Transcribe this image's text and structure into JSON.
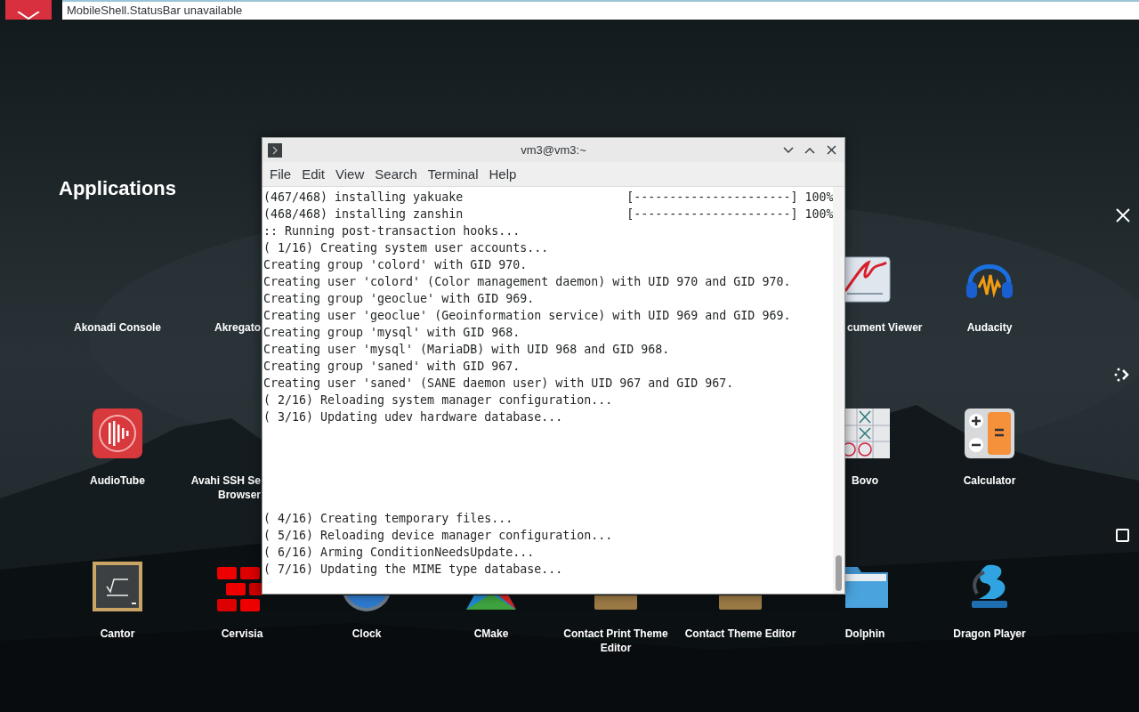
{
  "status_bar": {
    "text": "MobileShell.StatusBar unavailable"
  },
  "launcher": {
    "title": "Applications",
    "rows": [
      [
        {
          "label": "Akonadi Console"
        },
        {
          "label": "Akregato"
        },
        {
          "label": "cument Viewer"
        },
        {
          "label": "Audacity"
        }
      ],
      [
        {
          "label": "AudioTube"
        },
        {
          "label": "Avahi SSH Se\nBrowser"
        },
        {
          "label": "Bovo"
        },
        {
          "label": "Calculator"
        }
      ],
      [
        {
          "label": "Cantor"
        },
        {
          "label": "Cervisia"
        },
        {
          "label": "Clock"
        },
        {
          "label": "CMake"
        },
        {
          "label": "Contact Print Theme\nEditor"
        },
        {
          "label": "Contact Theme Editor"
        },
        {
          "label": "Dolphin"
        },
        {
          "label": "Dragon Player"
        }
      ]
    ]
  },
  "terminal": {
    "title": "vm3@vm3:~",
    "menu": [
      "File",
      "Edit",
      "View",
      "Search",
      "Terminal",
      "Help"
    ],
    "output": [
      "(467/468) installing yakuake                       [----------------------] 100%",
      "(468/468) installing zanshin                       [----------------------] 100%",
      ":: Running post-transaction hooks...",
      "( 1/16) Creating system user accounts...",
      "Creating group 'colord' with GID 970.",
      "Creating user 'colord' (Color management daemon) with UID 970 and GID 970.",
      "Creating group 'geoclue' with GID 969.",
      "Creating user 'geoclue' (Geoinformation service) with UID 969 and GID 969.",
      "Creating group 'mysql' with GID 968.",
      "Creating user 'mysql' (MariaDB) with UID 968 and GID 968.",
      "Creating group 'saned' with GID 967.",
      "Creating user 'saned' (SANE daemon user) with UID 967 and GID 967.",
      "( 2/16) Reloading system manager configuration...",
      "( 3/16) Updating udev hardware database..."
    ],
    "output_after_pause": [
      "( 4/16) Creating temporary files...",
      "( 5/16) Reloading device manager configuration...",
      "( 6/16) Arming ConditionNeedsUpdate...",
      "( 7/16) Updating the MIME type database..."
    ]
  }
}
